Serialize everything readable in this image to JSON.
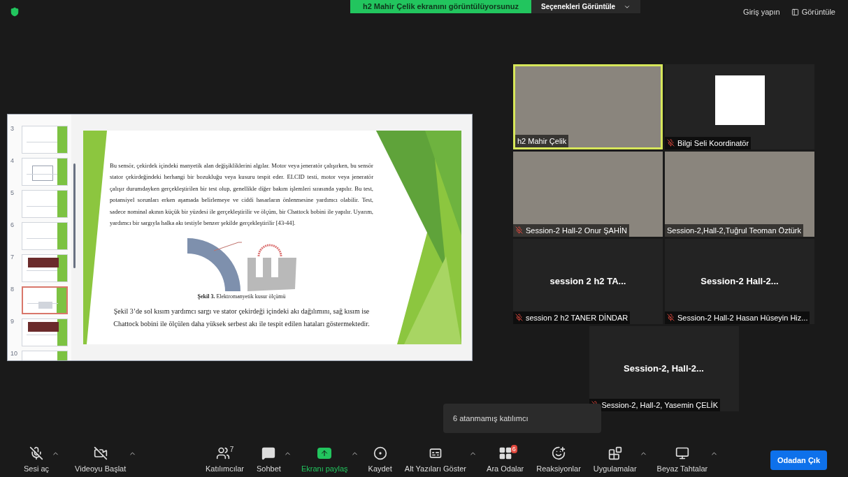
{
  "top_bar": {
    "sharing_notice": "h2 Mahir Çelik ekranını görüntülüyorsunuz",
    "view_options": "Seçenekleri Görüntüle",
    "sign_in": "Giriş yapın",
    "view": "Görüntüle"
  },
  "shared_screen": {
    "thumbnails": [
      {
        "number": "3",
        "kind": "text",
        "selected": false
      },
      {
        "number": "4",
        "kind": "chart",
        "selected": false
      },
      {
        "number": "5",
        "kind": "text",
        "selected": false
      },
      {
        "number": "6",
        "kind": "text",
        "selected": false
      },
      {
        "number": "7",
        "kind": "image",
        "selected": false
      },
      {
        "number": "8",
        "kind": "figure",
        "selected": true
      },
      {
        "number": "9",
        "kind": "image",
        "selected": false
      },
      {
        "number": "10",
        "kind": "text",
        "selected": false
      }
    ],
    "slide": {
      "paragraph": "Bu sensör, çekirdek içindeki manyetik alan değişikliklerini algılar. Motor veya jeneratör çalışırken, bu sensör stator çekirdeğindeki herhangi bir bozukluğu veya kusuru tespit eder. ELCID testi, motor veya jeneratör çalışır durumdayken gerçekleştirilen bir test olup, genellikle diğer bakım işlemleri sırasında yapılır. Bu test, potansiyel sorunları erken aşamada belirlemeye ve ciddi hasarların önlenmesine yardımcı olabilir. Test, sadece nominal akının küçük bir yüzdesi ile gerçekleştirilir ve ölçüm, bir Chattock bobini ile yapılır. Uyarım, yardımcı bir sargıyla halka akı testiyle benzer şekilde gerçekleştirilir [43-44].",
      "figure_caption": "**Şekil 3.** Elektromanyetik kusur ölçümü",
      "description": "Şekil 3’de sol kısım yardımcı sargı ve stator çekirdeği içindeki akı dağılımını, sağ kısım ise Chattock bobini ile ölçülen daha yüksek serbest akı ile tespit edilen hataları göstermektedir."
    }
  },
  "participants": [
    {
      "kind": "video",
      "name": "h2 Mahir Çelik",
      "muted": false,
      "speaking": true
    },
    {
      "kind": "logo",
      "name": "Bilgi Seli  Koordinatör",
      "muted": true,
      "speaking": false
    },
    {
      "kind": "video",
      "name": "Session-2 Hall-2 Onur ŞAHİN",
      "muted": true,
      "speaking": false
    },
    {
      "kind": "video",
      "name": "Session-2,Hall-2,Tuğrul Teoman Öztürk",
      "muted": false,
      "speaking": false
    },
    {
      "kind": "name",
      "display": "session 2 h2 TA...",
      "name": "session 2 h2 TANER DİNDAR",
      "muted": true,
      "speaking": false
    },
    {
      "kind": "name",
      "display": "Session-2  Hall-2...",
      "name": "Session-2 Hall-2 Hasan Hüseyin Hiz...",
      "muted": true,
      "speaking": false
    },
    {
      "kind": "name",
      "display": "Session-2,  Hall-2...",
      "name": "Session-2, Hall-2, Yasemin ÇELİK",
      "muted": true,
      "speaking": false
    }
  ],
  "toolbar": {
    "items": [
      {
        "kind": "mic",
        "label": "Sesi aç",
        "on": false,
        "menu": true
      },
      {
        "kind": "video",
        "label": "Videoyu Başlat",
        "on": false,
        "menu": true
      },
      {
        "kind": "participants",
        "label": "Katılımcılar",
        "count": "7",
        "menu": false
      },
      {
        "kind": "chat",
        "label": "Sohbet",
        "menu": true
      },
      {
        "kind": "share",
        "label": "Ekranı paylaş",
        "menu": true
      },
      {
        "kind": "record",
        "label": "Kaydet",
        "menu": false
      },
      {
        "kind": "captions",
        "label": "Alt Yazıları Göster",
        "menu": true
      },
      {
        "kind": "breakout",
        "label": "Ara Odalar",
        "badge": "6",
        "menu": false
      },
      {
        "kind": "reactions",
        "label": "Reaksiyonlar",
        "menu": false
      },
      {
        "kind": "apps",
        "label": "Uygulamalar",
        "menu": true
      },
      {
        "kind": "whiteboard",
        "label": "Beyaz Tahtalar",
        "menu": true
      }
    ],
    "leave": "Odadan Çık"
  },
  "tooltip": "6 atanmamış katılımcı"
}
